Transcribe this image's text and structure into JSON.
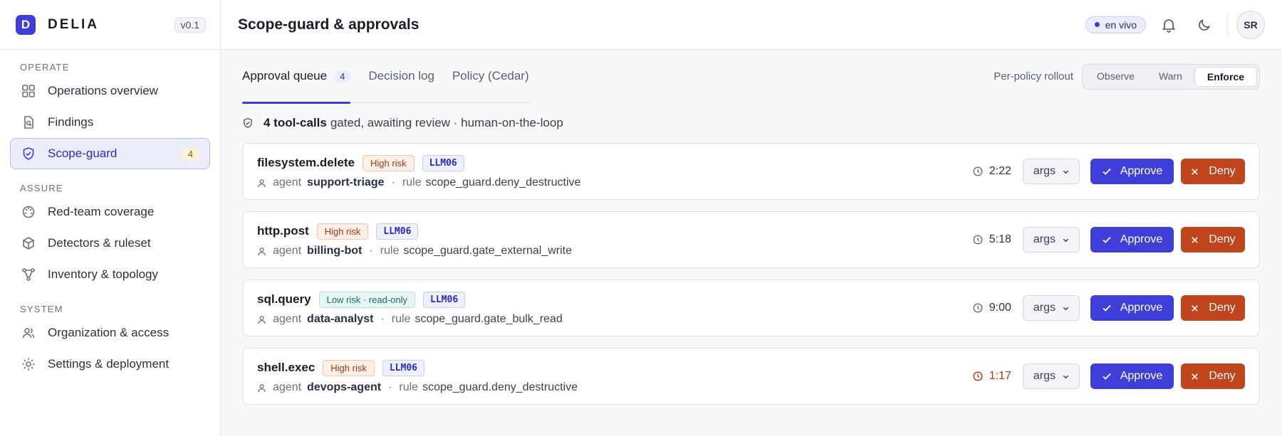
{
  "brand": {
    "letter": "D",
    "name": "DELIA",
    "version": "v0.1"
  },
  "sidebar": {
    "sections": [
      {
        "label": "OPERATE",
        "items": [
          {
            "label": "Operations overview",
            "icon": "grid-icon"
          },
          {
            "label": "Findings",
            "icon": "document-search-icon"
          },
          {
            "label": "Scope-guard",
            "icon": "shield-check-icon",
            "badge": "4",
            "active": true
          }
        ]
      },
      {
        "label": "ASSURE",
        "items": [
          {
            "label": "Red-team coverage",
            "icon": "target-icon"
          },
          {
            "label": "Detectors & ruleset",
            "icon": "cube-icon"
          },
          {
            "label": "Inventory & topology",
            "icon": "topology-icon"
          }
        ]
      },
      {
        "label": "SYSTEM",
        "items": [
          {
            "label": "Organization & access",
            "icon": "users-icon"
          },
          {
            "label": "Settings & deployment",
            "icon": "sun-gear-icon"
          }
        ]
      }
    ]
  },
  "header": {
    "title": "Scope-guard & approvals",
    "live_label": "en vivo",
    "avatar_initials": "SR"
  },
  "tabs": [
    {
      "label": "Approval queue",
      "count": "4",
      "active": true
    },
    {
      "label": "Decision log"
    },
    {
      "label": "Policy (Cedar)"
    }
  ],
  "rollout": {
    "label": "Per-policy rollout",
    "options": [
      "Observe",
      "Warn",
      "Enforce"
    ],
    "selected": "Enforce"
  },
  "summary": {
    "bold": "4 tool-calls",
    "rest": "gated, awaiting review · human-on-the-loop"
  },
  "queue": [
    {
      "tool": "filesystem.delete",
      "risk": "High risk",
      "risk_level": "high",
      "owasp": "LLM06",
      "agent_label": "agent",
      "agent": "support-triage",
      "rule_label": "rule",
      "rule": "scope_guard.deny_destructive",
      "timer": "2:22",
      "urgent": false,
      "args_label": "args",
      "approve_label": "Approve",
      "deny_label": "Deny"
    },
    {
      "tool": "http.post",
      "risk": "High risk",
      "risk_level": "high",
      "owasp": "LLM06",
      "agent_label": "agent",
      "agent": "billing-bot",
      "rule_label": "rule",
      "rule": "scope_guard.gate_external_write",
      "timer": "5:18",
      "urgent": false,
      "args_label": "args",
      "approve_label": "Approve",
      "deny_label": "Deny"
    },
    {
      "tool": "sql.query",
      "risk": "Low risk · read-only",
      "risk_level": "low",
      "owasp": "LLM06",
      "agent_label": "agent",
      "agent": "data-analyst",
      "rule_label": "rule",
      "rule": "scope_guard.gate_bulk_read",
      "timer": "9:00",
      "urgent": false,
      "args_label": "args",
      "approve_label": "Approve",
      "deny_label": "Deny"
    },
    {
      "tool": "shell.exec",
      "risk": "High risk",
      "risk_level": "high",
      "owasp": "LLM06",
      "agent_label": "agent",
      "agent": "devops-agent",
      "rule_label": "rule",
      "rule": "scope_guard.deny_destructive",
      "timer": "1:17",
      "urgent": true,
      "args_label": "args",
      "approve_label": "Approve",
      "deny_label": "Deny"
    }
  ],
  "colors": {
    "accent": "#3d3fd8",
    "deny": "#c0441c",
    "urgent": "#b4380f"
  }
}
